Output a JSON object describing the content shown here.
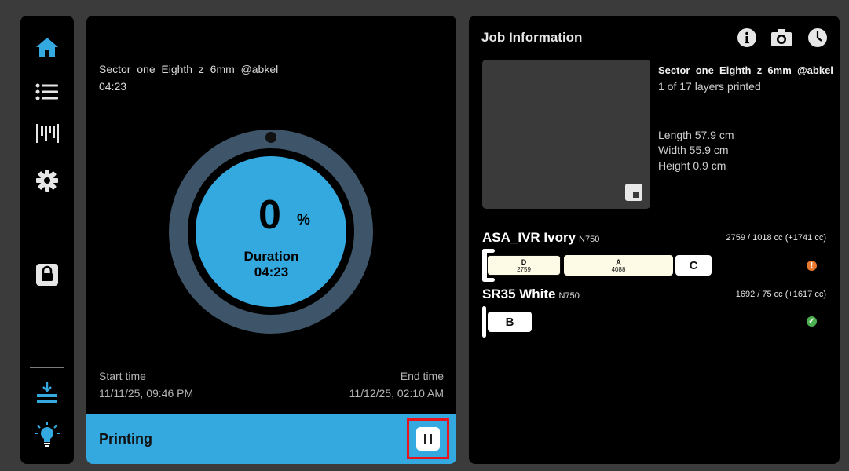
{
  "colors": {
    "accent": "#33a9e0",
    "ring": "#3e5468",
    "warning": "#e8782e",
    "ok": "#4caf50",
    "highlight": "#e8141c"
  },
  "sidebar": {
    "items": [
      {
        "icon": "home-icon",
        "active": true
      },
      {
        "icon": "list-icon",
        "active": false
      },
      {
        "icon": "material-icon",
        "active": false
      },
      {
        "icon": "gear-icon",
        "active": false
      },
      {
        "icon": "lock-icon",
        "active": false
      },
      {
        "icon": "unload-icon",
        "active": false
      },
      {
        "icon": "light-bulb-icon",
        "active": false
      }
    ]
  },
  "job": {
    "name": "Sector_one_Eighth_z_6mm_@abkel",
    "elapsed": "04:23",
    "progress_percent": 0,
    "percent_value": "0",
    "percent_sign": "%",
    "duration_label": "Duration",
    "duration_value": "04:23",
    "start_label": "Start time",
    "start_value": "11/11/25, 09:46 PM",
    "end_label": "End time",
    "end_value": "11/12/25, 02:10 AM",
    "status": "Printing"
  },
  "info": {
    "title": "Job Information",
    "icons": [
      "info-icon",
      "camera-icon",
      "history-icon"
    ],
    "name": "Sector_one_Eighth_z_6mm_@abkel",
    "layers": "1 of 17 layers printed",
    "length": "Length 57.9 cm",
    "width": "Width 55.9 cm",
    "height": "Height 0.9 cm"
  },
  "materials": [
    {
      "name": "ASA_IVR Ivory",
      "code": "N750",
      "volume": "2759 / 1018 cc (+1741 cc)",
      "status": "warning",
      "status_glyph": "!",
      "spools": [
        {
          "slot": "D",
          "amount": "2759"
        },
        {
          "slot": "A",
          "amount": "4088"
        },
        {
          "slot": "C",
          "amount": ""
        }
      ]
    },
    {
      "name": "SR35 White",
      "code": "N750",
      "volume": "1692 / 75 cc (+1617 cc)",
      "status": "ok",
      "status_glyph": "✓",
      "spools": [
        {
          "slot": "B",
          "amount": ""
        }
      ]
    }
  ]
}
